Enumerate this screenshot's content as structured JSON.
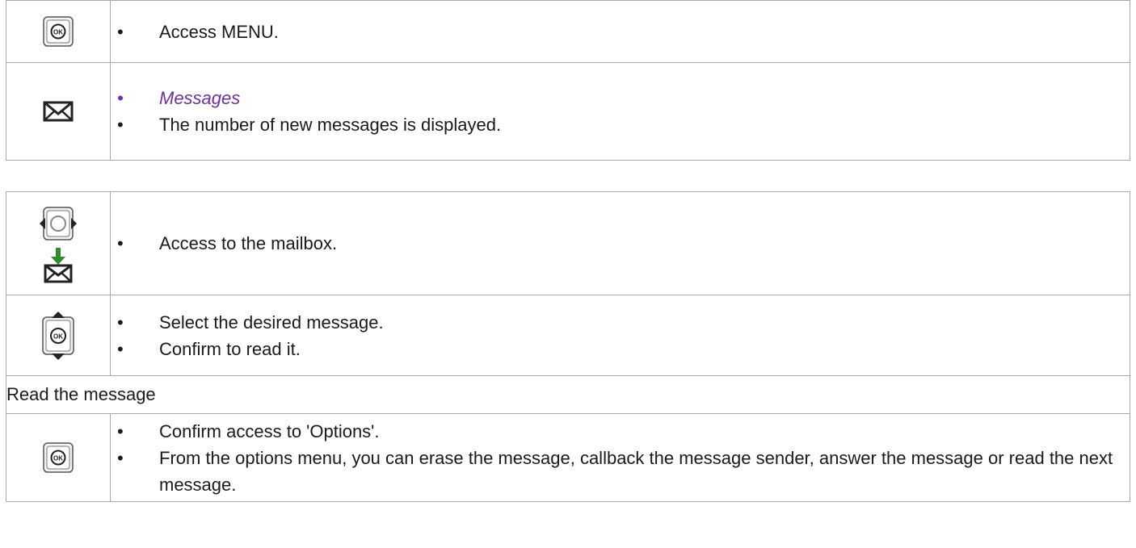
{
  "table1": {
    "row1": {
      "icon": "ok-button-icon",
      "bullets": [
        "Access MENU."
      ]
    },
    "row2": {
      "icon": "envelope-icon",
      "bullets_label": "Messages",
      "bullets": [
        "The number of new messages is displayed."
      ]
    }
  },
  "table2": {
    "row1": {
      "icons": [
        "navigator-left-right-icon",
        "mailbox-download-icon"
      ],
      "bullets": [
        "Access to the mailbox."
      ]
    },
    "row2": {
      "icon": "navigator-up-down-ok-icon",
      "bullets": [
        "Select the desired message.",
        "Confirm to read it."
      ]
    },
    "row3": {
      "text": "Read the message"
    },
    "row4": {
      "icon": "ok-button-icon",
      "bullets": [
        "Confirm access to 'Options'.",
        "From the options menu, you can erase the message, callback the message sender, answer the message or read the next message."
      ]
    }
  },
  "colors": {
    "border": "#a8a8a8",
    "emphasis": "#7030a0",
    "arrow_green": "#2e8b2e"
  }
}
